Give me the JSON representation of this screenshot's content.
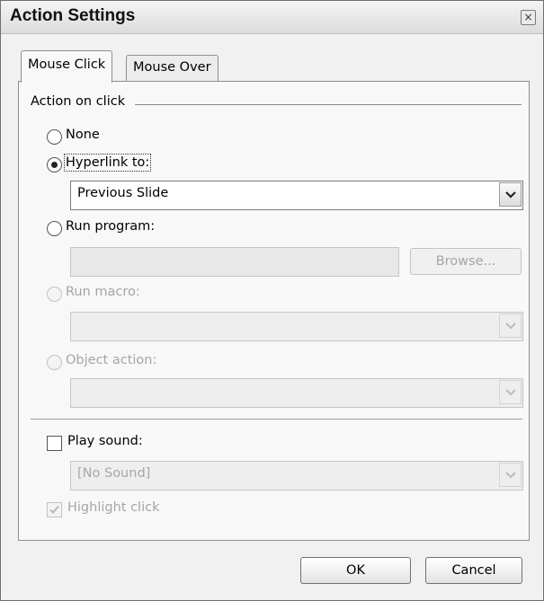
{
  "dialog": {
    "title": "Action Settings",
    "close_glyph": "×"
  },
  "tabs": [
    {
      "label": "Mouse Click",
      "active": true
    },
    {
      "label": "Mouse Over",
      "active": false
    }
  ],
  "group": {
    "label": "Action on click"
  },
  "options": {
    "none": {
      "label": "None",
      "checked": false,
      "enabled": true
    },
    "hyperlink": {
      "label": "Hyperlink to:",
      "checked": true,
      "enabled": true,
      "value": "Previous Slide"
    },
    "run_program": {
      "label": "Run program:",
      "checked": false,
      "enabled": true,
      "value": "",
      "browse_label": "Browse..."
    },
    "run_macro": {
      "label": "Run macro:",
      "checked": false,
      "enabled": false,
      "value": ""
    },
    "object_action": {
      "label": "Object action:",
      "checked": false,
      "enabled": false,
      "value": ""
    }
  },
  "sound": {
    "label": "Play sound:",
    "checked": false,
    "value": "[No Sound]"
  },
  "highlight": {
    "label": "Highlight click",
    "checked": true,
    "enabled": false
  },
  "buttons": {
    "ok": "OK",
    "cancel": "Cancel"
  },
  "icons": {
    "close": "close-icon",
    "dropdown": "chevron-down-icon",
    "check": "check-icon"
  }
}
